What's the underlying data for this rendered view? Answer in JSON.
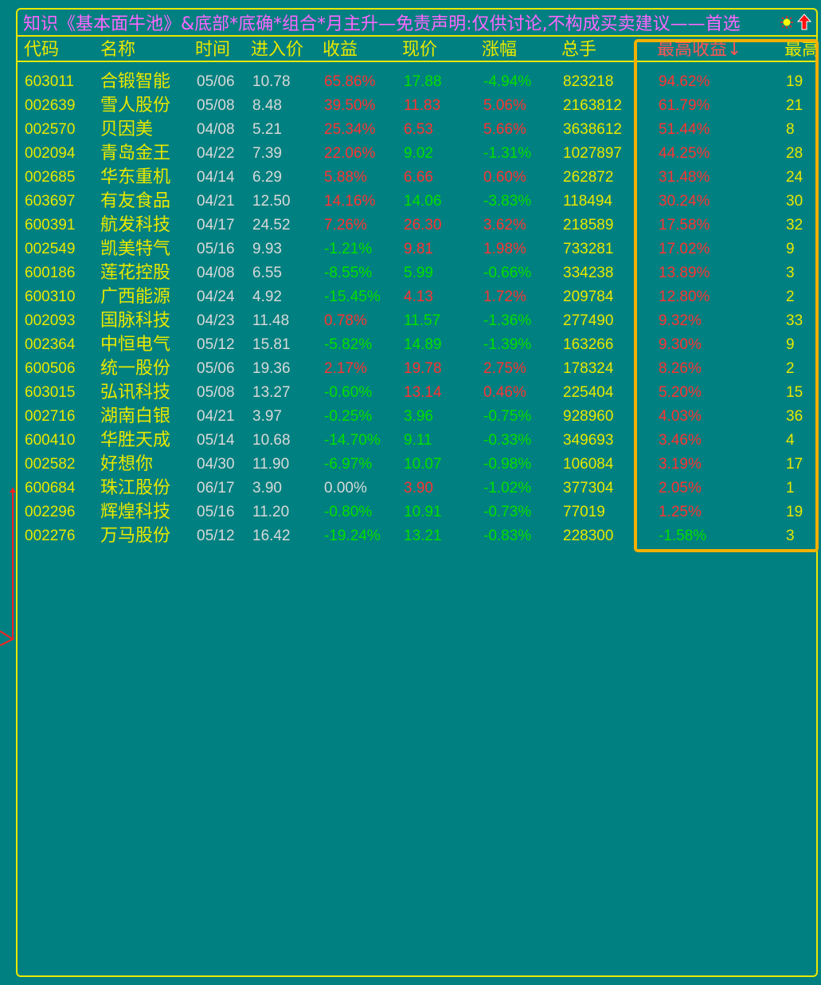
{
  "title": "知识《基本面牛池》&底部*底确*组合*月主升—免责声明:仅供讨论,不构成买卖建议——首选",
  "icons": {
    "sun": "sun-icon",
    "up": "up-arrow-icon"
  },
  "colors": {
    "background": "#008080",
    "border": "#e8e800",
    "highlight": "#f4b000",
    "up": "#ff3333",
    "down": "#00e000",
    "flat": "#d8d8d8"
  },
  "columns": {
    "code": "代码",
    "name": "名称",
    "time": "时间",
    "entry": "进入价",
    "gain": "收益",
    "price": "现价",
    "change": "涨幅",
    "volume": "总手",
    "max_gain": "最高收益↓",
    "max_more": "最高"
  },
  "rows": [
    {
      "code": "603011",
      "name": "合锻智能",
      "time": "05/06",
      "entry": "10.78",
      "gain": "65.86%",
      "gain_c": "r",
      "price": "17.88",
      "price_c": "g",
      "change": "-4.94%",
      "change_c": "g",
      "volume": "823218",
      "max_gain": "94.62%",
      "max_gain_c": "r",
      "extra": "19"
    },
    {
      "code": "002639",
      "name": "雪人股份",
      "time": "05/08",
      "entry": "8.48",
      "gain": "39.50%",
      "gain_c": "r",
      "price": "11.83",
      "price_c": "r",
      "change": "5.06%",
      "change_c": "r",
      "volume": "2163812",
      "max_gain": "61.79%",
      "max_gain_c": "r",
      "extra": "21"
    },
    {
      "code": "002570",
      "name": "贝因美",
      "time": "04/08",
      "entry": "5.21",
      "gain": "25.34%",
      "gain_c": "r",
      "price": "6.53",
      "price_c": "r",
      "change": "5.66%",
      "change_c": "r",
      "volume": "3638612",
      "max_gain": "51.44%",
      "max_gain_c": "r",
      "extra": "8"
    },
    {
      "code": "002094",
      "name": "青岛金王",
      "time": "04/22",
      "entry": "7.39",
      "gain": "22.06%",
      "gain_c": "r",
      "price": "9.02",
      "price_c": "g",
      "change": "-1.31%",
      "change_c": "g",
      "volume": "1027897",
      "max_gain": "44.25%",
      "max_gain_c": "r",
      "extra": "28"
    },
    {
      "code": "002685",
      "name": "华东重机",
      "time": "04/14",
      "entry": "6.29",
      "gain": "5.88%",
      "gain_c": "r",
      "price": "6.66",
      "price_c": "r",
      "change": "0.60%",
      "change_c": "r",
      "volume": "262872",
      "max_gain": "31.48%",
      "max_gain_c": "r",
      "extra": "24"
    },
    {
      "code": "603697",
      "name": "有友食品",
      "time": "04/21",
      "entry": "12.50",
      "gain": "14.16%",
      "gain_c": "r",
      "price": "14.06",
      "price_c": "g",
      "change": "-3.83%",
      "change_c": "g",
      "volume": "118494",
      "max_gain": "30.24%",
      "max_gain_c": "r",
      "extra": "30"
    },
    {
      "code": "600391",
      "name": "航发科技",
      "time": "04/17",
      "entry": "24.52",
      "gain": "7.26%",
      "gain_c": "r",
      "price": "26.30",
      "price_c": "r",
      "change": "3.62%",
      "change_c": "r",
      "volume": "218589",
      "max_gain": "17.58%",
      "max_gain_c": "r",
      "extra": "32"
    },
    {
      "code": "002549",
      "name": "凯美特气",
      "time": "05/16",
      "entry": "9.93",
      "gain": "-1.21%",
      "gain_c": "g",
      "price": "9.81",
      "price_c": "r",
      "change": "1.98%",
      "change_c": "r",
      "volume": "733281",
      "max_gain": "17.02%",
      "max_gain_c": "r",
      "extra": "9"
    },
    {
      "code": "600186",
      "name": "莲花控股",
      "time": "04/08",
      "entry": "6.55",
      "gain": "-8.55%",
      "gain_c": "g",
      "price": "5.99",
      "price_c": "g",
      "change": "-0.66%",
      "change_c": "g",
      "volume": "334238",
      "max_gain": "13.89%",
      "max_gain_c": "r",
      "extra": "3"
    },
    {
      "code": "600310",
      "name": "广西能源",
      "time": "04/24",
      "entry": "4.92",
      "gain": "-15.45%",
      "gain_c": "g",
      "price": "4.13",
      "price_c": "r",
      "change": "1.72%",
      "change_c": "r",
      "volume": "209784",
      "max_gain": "12.80%",
      "max_gain_c": "r",
      "extra": "2"
    },
    {
      "code": "002093",
      "name": "国脉科技",
      "time": "04/23",
      "entry": "11.48",
      "gain": "0.78%",
      "gain_c": "r",
      "price": "11.57",
      "price_c": "g",
      "change": "-1.36%",
      "change_c": "g",
      "volume": "277490",
      "max_gain": "9.32%",
      "max_gain_c": "r",
      "extra": "33"
    },
    {
      "code": "002364",
      "name": "中恒电气",
      "time": "05/12",
      "entry": "15.81",
      "gain": "-5.82%",
      "gain_c": "g",
      "price": "14.89",
      "price_c": "g",
      "change": "-1.39%",
      "change_c": "g",
      "volume": "163266",
      "max_gain": "9.30%",
      "max_gain_c": "r",
      "extra": "9"
    },
    {
      "code": "600506",
      "name": "统一股份",
      "time": "05/06",
      "entry": "19.36",
      "gain": "2.17%",
      "gain_c": "r",
      "price": "19.78",
      "price_c": "r",
      "change": "2.75%",
      "change_c": "r",
      "volume": "178324",
      "max_gain": "8.26%",
      "max_gain_c": "r",
      "extra": "2"
    },
    {
      "code": "603015",
      "name": "弘讯科技",
      "time": "05/08",
      "entry": "13.27",
      "gain": "-0.60%",
      "gain_c": "g",
      "price": "13.14",
      "price_c": "r",
      "change": "0.46%",
      "change_c": "r",
      "volume": "225404",
      "max_gain": "5.20%",
      "max_gain_c": "r",
      "extra": "15"
    },
    {
      "code": "002716",
      "name": "湖南白银",
      "time": "04/21",
      "entry": "3.97",
      "gain": "-0.25%",
      "gain_c": "g",
      "price": "3.96",
      "price_c": "g",
      "change": "-0.75%",
      "change_c": "g",
      "volume": "928960",
      "max_gain": "4.03%",
      "max_gain_c": "r",
      "extra": "36"
    },
    {
      "code": "600410",
      "name": "华胜天成",
      "time": "05/14",
      "entry": "10.68",
      "gain": "-14.70%",
      "gain_c": "g",
      "price": "9.11",
      "price_c": "g",
      "change": "-0.33%",
      "change_c": "g",
      "volume": "349693",
      "max_gain": "3.46%",
      "max_gain_c": "r",
      "extra": "4"
    },
    {
      "code": "002582",
      "name": "好想你",
      "time": "04/30",
      "entry": "11.90",
      "gain": "-6.97%",
      "gain_c": "g",
      "price": "10.07",
      "price_c": "g",
      "change": "-0.98%",
      "change_c": "g",
      "volume": "106084",
      "max_gain": "3.19%",
      "max_gain_c": "r",
      "extra": "17"
    },
    {
      "code": "600684",
      "name": "珠江股份",
      "time": "06/17",
      "entry": "3.90",
      "gain": "0.00%",
      "gain_c": "w",
      "price": "3.90",
      "price_c": "r",
      "change": "-1.02%",
      "change_c": "g",
      "volume": "377304",
      "max_gain": "2.05%",
      "max_gain_c": "r",
      "extra": "1"
    },
    {
      "code": "002296",
      "name": "辉煌科技",
      "time": "05/16",
      "entry": "11.20",
      "gain": "-0.80%",
      "gain_c": "g",
      "price": "10.91",
      "price_c": "g",
      "change": "-0.73%",
      "change_c": "g",
      "volume": "77019",
      "max_gain": "1.25%",
      "max_gain_c": "r",
      "extra": "19"
    },
    {
      "code": "002276",
      "name": "万马股份",
      "time": "05/12",
      "entry": "16.42",
      "gain": "-19.24%",
      "gain_c": "g",
      "price": "13.21",
      "price_c": "g",
      "change": "-0.83%",
      "change_c": "g",
      "volume": "228300",
      "max_gain": "-1.58%",
      "max_gain_c": "g",
      "extra": "3"
    }
  ]
}
